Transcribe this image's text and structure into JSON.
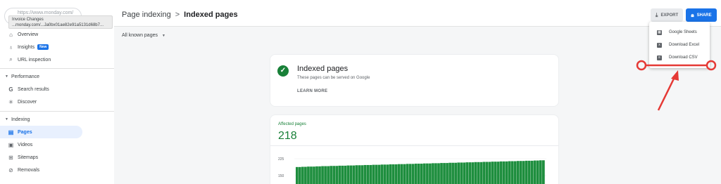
{
  "sidebar": {
    "property": "https://www.monday.com/",
    "tooltip_line1": "Invoice Changes",
    "tooltip_line2": "...monday.com/...Ja0bx01ae82e91a5131d68b7...",
    "items_top": [
      {
        "label": "Overview",
        "icon": "home-icon"
      },
      {
        "label": "Insights",
        "icon": "insights-icon",
        "badge": "New"
      },
      {
        "label": "URL inspection",
        "icon": "search-icon"
      }
    ],
    "performance_label": "Performance",
    "performance_items": [
      {
        "label": "Search results",
        "icon": "google-icon"
      },
      {
        "label": "Discover",
        "icon": "discover-icon"
      }
    ],
    "indexing_label": "Indexing",
    "indexing_items": [
      {
        "label": "Pages",
        "icon": "pages-icon"
      },
      {
        "label": "Videos",
        "icon": "videos-icon"
      },
      {
        "label": "Sitemaps",
        "icon": "sitemaps-icon"
      },
      {
        "label": "Removals",
        "icon": "removals-icon"
      }
    ]
  },
  "header": {
    "crumb_parent": "Page indexing",
    "crumb_sep": ">",
    "crumb_current": "Indexed pages",
    "export_label": "EXPORT",
    "share_label": "SHARE"
  },
  "filter": {
    "label": "All known pages"
  },
  "export_menu": [
    {
      "label": "Google Sheets",
      "icon": "sheets-icon"
    },
    {
      "label": "Download Excel",
      "icon": "excel-icon"
    },
    {
      "label": "Download CSV",
      "icon": "csv-icon"
    }
  ],
  "summary_card": {
    "title": "Indexed pages",
    "subtitle": "These pages can be served on Google",
    "link": "LEARN MORE"
  },
  "affected": {
    "label": "Affected pages",
    "value": "218",
    "y_ticks": [
      "225",
      "150"
    ]
  },
  "colors": {
    "accent": "#1a73e8",
    "green": "#188038",
    "bar_green": "#1e8e3e",
    "annotation_red": "#e53935"
  },
  "chart_data": {
    "type": "bar",
    "xlabel": "",
    "ylabel": "",
    "ylim": [
      0,
      250
    ],
    "values": [
      188,
      188,
      189,
      189,
      190,
      190,
      190,
      191,
      191,
      192,
      192,
      192,
      193,
      193,
      193,
      194,
      194,
      194,
      195,
      195,
      195,
      196,
      196,
      196,
      197,
      197,
      197,
      198,
      198,
      198,
      199,
      199,
      199,
      200,
      200,
      200,
      201,
      201,
      201,
      202,
      202,
      202,
      203,
      203,
      203,
      204,
      204,
      204,
      205,
      205,
      205,
      206,
      206,
      206,
      207,
      207,
      207,
      208,
      208,
      208,
      209,
      209,
      209,
      210,
      210,
      210,
      211,
      211,
      211,
      212,
      212,
      212,
      213,
      213,
      213,
      214,
      214,
      214,
      215,
      215,
      215,
      216,
      216,
      216,
      217,
      217,
      218,
      218
    ]
  }
}
